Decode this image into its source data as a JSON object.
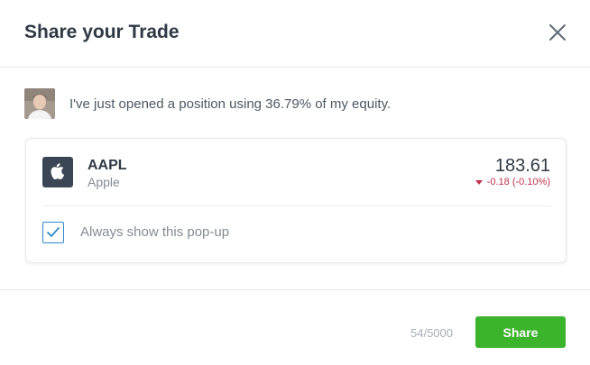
{
  "dialog": {
    "title": "Share your Trade",
    "close_icon": "close-icon"
  },
  "message": {
    "avatar": "user-avatar",
    "text": "I've just opened a position using 36.79% of my equity."
  },
  "instrument": {
    "logo_icon": "apple-logo-icon",
    "symbol": "AAPL",
    "company": "Apple",
    "price": "183.61",
    "change": "-0.18 (-0.10%)",
    "change_direction": "down",
    "change_color": "#c0334a"
  },
  "popup_option": {
    "checked": true,
    "label": "Always show this pop-up"
  },
  "footer": {
    "char_count": "54/5000",
    "share_label": "Share",
    "share_color": "#3bb32a"
  }
}
